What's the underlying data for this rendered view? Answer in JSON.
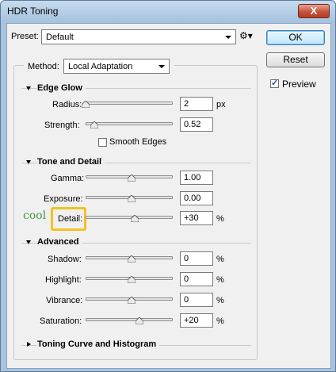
{
  "window": {
    "title": "HDR Toning",
    "close_label": "X"
  },
  "preset": {
    "label": "Preset:",
    "value": "Default",
    "gear_glyph": "⚙▾"
  },
  "buttons": {
    "ok": "OK",
    "reset": "Reset"
  },
  "preview": {
    "label": "Preview",
    "checked": true
  },
  "method": {
    "label": "Method:",
    "value": "Local Adaptation"
  },
  "edge_glow": {
    "title": "Edge Glow",
    "radius": {
      "label": "Radius:",
      "value": "2",
      "unit": "px",
      "slider_fraction": 0.0
    },
    "strength": {
      "label": "Strength:",
      "value": "0.52",
      "unit": "",
      "slider_fraction": 0.1
    },
    "smooth_edges": {
      "label": "Smooth Edges",
      "checked": false
    }
  },
  "tone_and_detail": {
    "title": "Tone and Detail",
    "gamma": {
      "label": "Gamma:",
      "value": "1.00",
      "unit": "",
      "slider_fraction": 0.5
    },
    "exposure": {
      "label": "Exposure:",
      "value": "0.00",
      "unit": "",
      "slider_fraction": 0.5
    },
    "detail": {
      "label": "Detail:",
      "value": "+30",
      "unit": "%",
      "slider_fraction": 0.56
    },
    "annotation": "cool"
  },
  "advanced": {
    "title": "Advanced",
    "shadow": {
      "label": "Shadow:",
      "value": "0",
      "unit": "%",
      "slider_fraction": 0.5
    },
    "highlight": {
      "label": "Highlight:",
      "value": "0",
      "unit": "%",
      "slider_fraction": 0.5
    },
    "vibrance": {
      "label": "Vibrance:",
      "value": "0",
      "unit": "%",
      "slider_fraction": 0.5
    },
    "saturation": {
      "label": "Saturation:",
      "value": "+20",
      "unit": "%",
      "slider_fraction": 0.6
    }
  },
  "toning_curve": {
    "title": "Toning Curve and Histogram"
  },
  "colors": {
    "highlight_box": "#f0c420",
    "annotation": "#3f9a3f",
    "title_bar": "#a9c3dd"
  }
}
